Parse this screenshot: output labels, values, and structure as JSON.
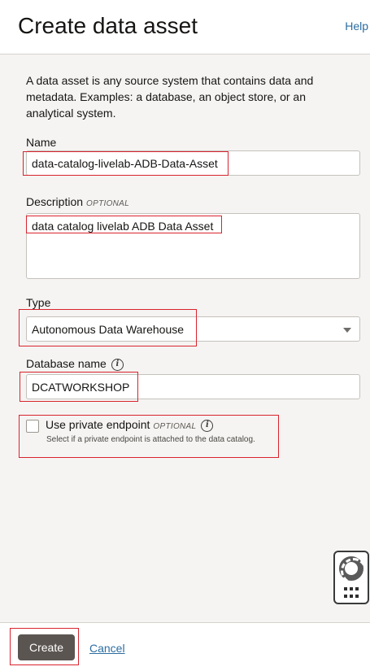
{
  "header": {
    "title": "Create data asset",
    "help": "Help"
  },
  "intro": "A data asset is any source system that contains data and metadata. Examples: a database, an object store, or an analytical system.",
  "optional_tag": "OPTIONAL",
  "form": {
    "name": {
      "label": "Name",
      "value": "data-catalog-livelab-ADB-Data-Asset"
    },
    "description": {
      "label": "Description",
      "value": "data catalog livelab ADB Data Asset"
    },
    "type": {
      "label": "Type",
      "value": "Autonomous Data Warehouse"
    },
    "database_name": {
      "label": "Database name",
      "value": "DCATWORKSHOP"
    },
    "private_endpoint": {
      "label": "Use private endpoint",
      "hint": "Select if a private endpoint is attached to the data catalog.",
      "checked": false
    }
  },
  "footer": {
    "create": "Create",
    "cancel": "Cancel"
  },
  "highlight_color": "#d9232e",
  "icons": [
    "info-icon",
    "chevron-down-icon",
    "lifebuoy-icon",
    "grid-dots-icon"
  ]
}
